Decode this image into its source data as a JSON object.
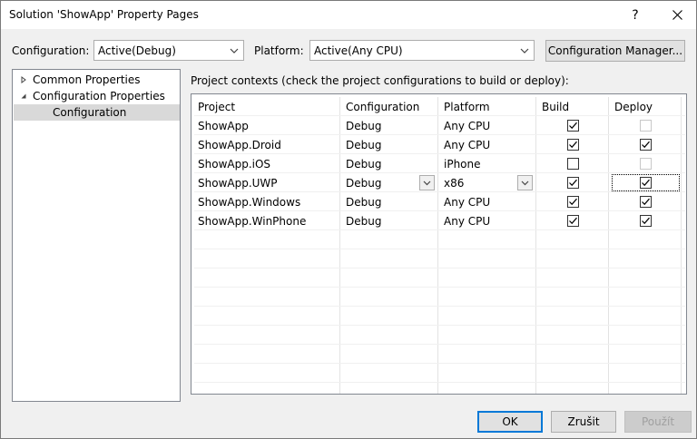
{
  "window": {
    "title": "Solution 'ShowApp' Property Pages",
    "help_glyph": "?",
    "close_glyph": "✕"
  },
  "toolbar": {
    "configuration_label": "Configuration:",
    "configuration_value": "Active(Debug)",
    "platform_label": "Platform:",
    "platform_value": "Active(Any CPU)",
    "config_manager_label": "Configuration Manager..."
  },
  "tree": {
    "items": [
      {
        "label": "Common Properties",
        "expander": "collapsed"
      },
      {
        "label": "Configuration Properties",
        "expander": "expanded"
      },
      {
        "label": "Configuration",
        "selected": true
      }
    ]
  },
  "contexts": {
    "label": "Project contexts (check the project configurations to build or deploy):",
    "headers": [
      "Project",
      "Configuration",
      "Platform",
      "Build",
      "Deploy"
    ],
    "rows": [
      {
        "project": "ShowApp",
        "configuration": "Debug",
        "platform": "Any CPU",
        "build": true,
        "deploy": false,
        "deploy_enabled": false
      },
      {
        "project": "ShowApp.Droid",
        "configuration": "Debug",
        "platform": "Any CPU",
        "build": true,
        "deploy": true,
        "deploy_enabled": true
      },
      {
        "project": "ShowApp.iOS",
        "configuration": "Debug",
        "platform": "iPhone",
        "build": false,
        "deploy": false,
        "deploy_enabled": false
      },
      {
        "project": "ShowApp.UWP",
        "configuration": "Debug",
        "platform": "x86",
        "build": true,
        "deploy": true,
        "deploy_enabled": true,
        "editing": true
      },
      {
        "project": "ShowApp.Windows",
        "configuration": "Debug",
        "platform": "Any CPU",
        "build": true,
        "deploy": true,
        "deploy_enabled": true
      },
      {
        "project": "ShowApp.WinPhone",
        "configuration": "Debug",
        "platform": "Any CPU",
        "build": true,
        "deploy": true,
        "deploy_enabled": true
      }
    ]
  },
  "footer": {
    "ok_label": "OK",
    "cancel_label": "Zrušit",
    "apply_label": "Použít"
  },
  "icons": {
    "help": "help-icon",
    "close": "close-icon",
    "dropdown": "chevron-down-icon",
    "tree_collapsed": "triangle-right-icon",
    "tree_expanded": "triangle-down-icon",
    "check": "checkmark-icon"
  }
}
